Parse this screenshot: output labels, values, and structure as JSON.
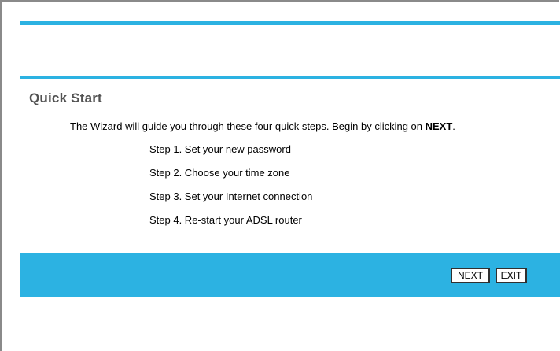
{
  "page": {
    "title": "Quick Start",
    "intro_text": "The Wizard will guide you through these four quick steps. Begin by clicking on ",
    "intro_emphasis": "NEXT",
    "intro_end": "."
  },
  "steps": [
    "Step 1. Set your new password",
    "Step 2. Choose your time zone",
    "Step 3. Set your Internet connection",
    "Step 4. Re-start your ADSL router"
  ],
  "buttons": {
    "next_label": "NEXT",
    "exit_label": "EXIT"
  },
  "colors": {
    "accent": "#2cb2e2",
    "title": "#535353",
    "frame_border": "#8a8a8a"
  }
}
